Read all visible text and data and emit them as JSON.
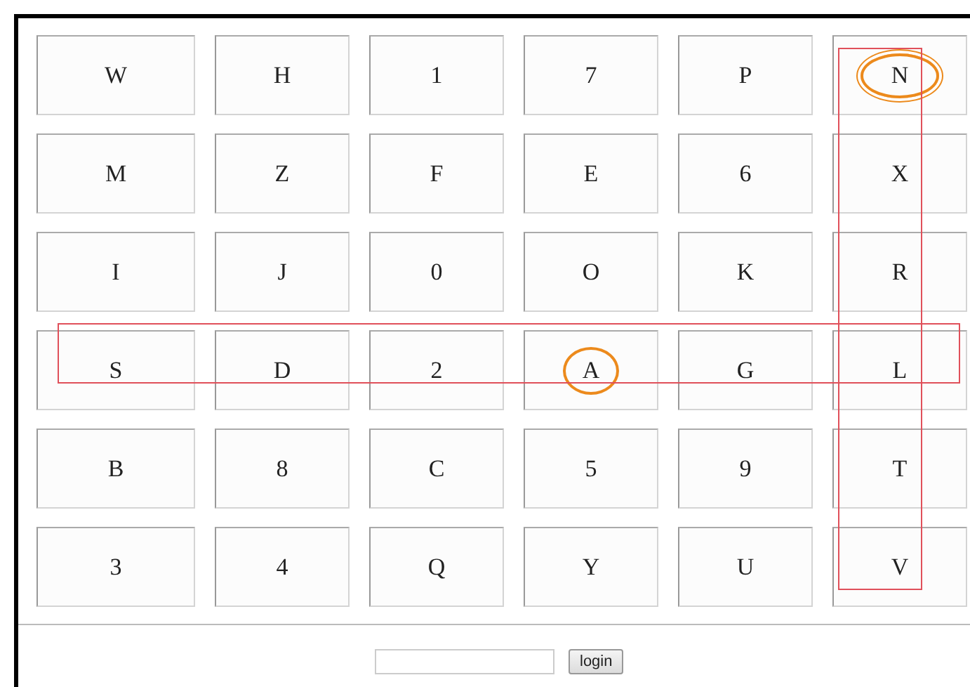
{
  "rows": [
    {
      "highlighted": false,
      "keys": [
        {
          "label": "W",
          "circled": false
        },
        {
          "label": "H",
          "circled": false
        },
        {
          "label": "1",
          "circled": false
        },
        {
          "label": "7",
          "circled": false
        },
        {
          "label": "P",
          "circled": false
        },
        {
          "label": "N",
          "circled": true,
          "double": true
        }
      ]
    },
    {
      "highlighted": false,
      "keys": [
        {
          "label": "M",
          "circled": false
        },
        {
          "label": "Z",
          "circled": false
        },
        {
          "label": "F",
          "circled": false
        },
        {
          "label": "E",
          "circled": false
        },
        {
          "label": "6",
          "circled": false
        },
        {
          "label": "X",
          "circled": false
        }
      ]
    },
    {
      "highlighted": false,
      "keys": [
        {
          "label": "I",
          "circled": false
        },
        {
          "label": "J",
          "circled": false
        },
        {
          "label": "0",
          "circled": false
        },
        {
          "label": "O",
          "circled": false
        },
        {
          "label": "K",
          "circled": false
        },
        {
          "label": "R",
          "circled": false
        }
      ]
    },
    {
      "highlighted": true,
      "keys": [
        {
          "label": "S",
          "circled": false
        },
        {
          "label": "D",
          "circled": false
        },
        {
          "label": "2",
          "circled": false
        },
        {
          "label": "A",
          "circled": true
        },
        {
          "label": "G",
          "circled": false
        },
        {
          "label": "L",
          "circled": false
        }
      ]
    },
    {
      "highlighted": false,
      "keys": [
        {
          "label": "B",
          "circled": false
        },
        {
          "label": "8",
          "circled": false
        },
        {
          "label": "C",
          "circled": false
        },
        {
          "label": "5",
          "circled": false
        },
        {
          "label": "9",
          "circled": false
        },
        {
          "label": "T",
          "circled": false
        }
      ]
    },
    {
      "highlighted": false,
      "keys": [
        {
          "label": "3",
          "circled": false
        },
        {
          "label": "4",
          "circled": false
        },
        {
          "label": "Q",
          "circled": false
        },
        {
          "label": "Y",
          "circled": false
        },
        {
          "label": "U",
          "circled": false
        },
        {
          "label": "V",
          "circled": false
        }
      ]
    }
  ],
  "columns": [
    {
      "highlighted": false
    },
    {
      "highlighted": false
    },
    {
      "highlighted": false
    },
    {
      "highlighted": false
    },
    {
      "highlighted": false
    },
    {
      "highlighted": true
    }
  ],
  "login": {
    "button": "login"
  }
}
